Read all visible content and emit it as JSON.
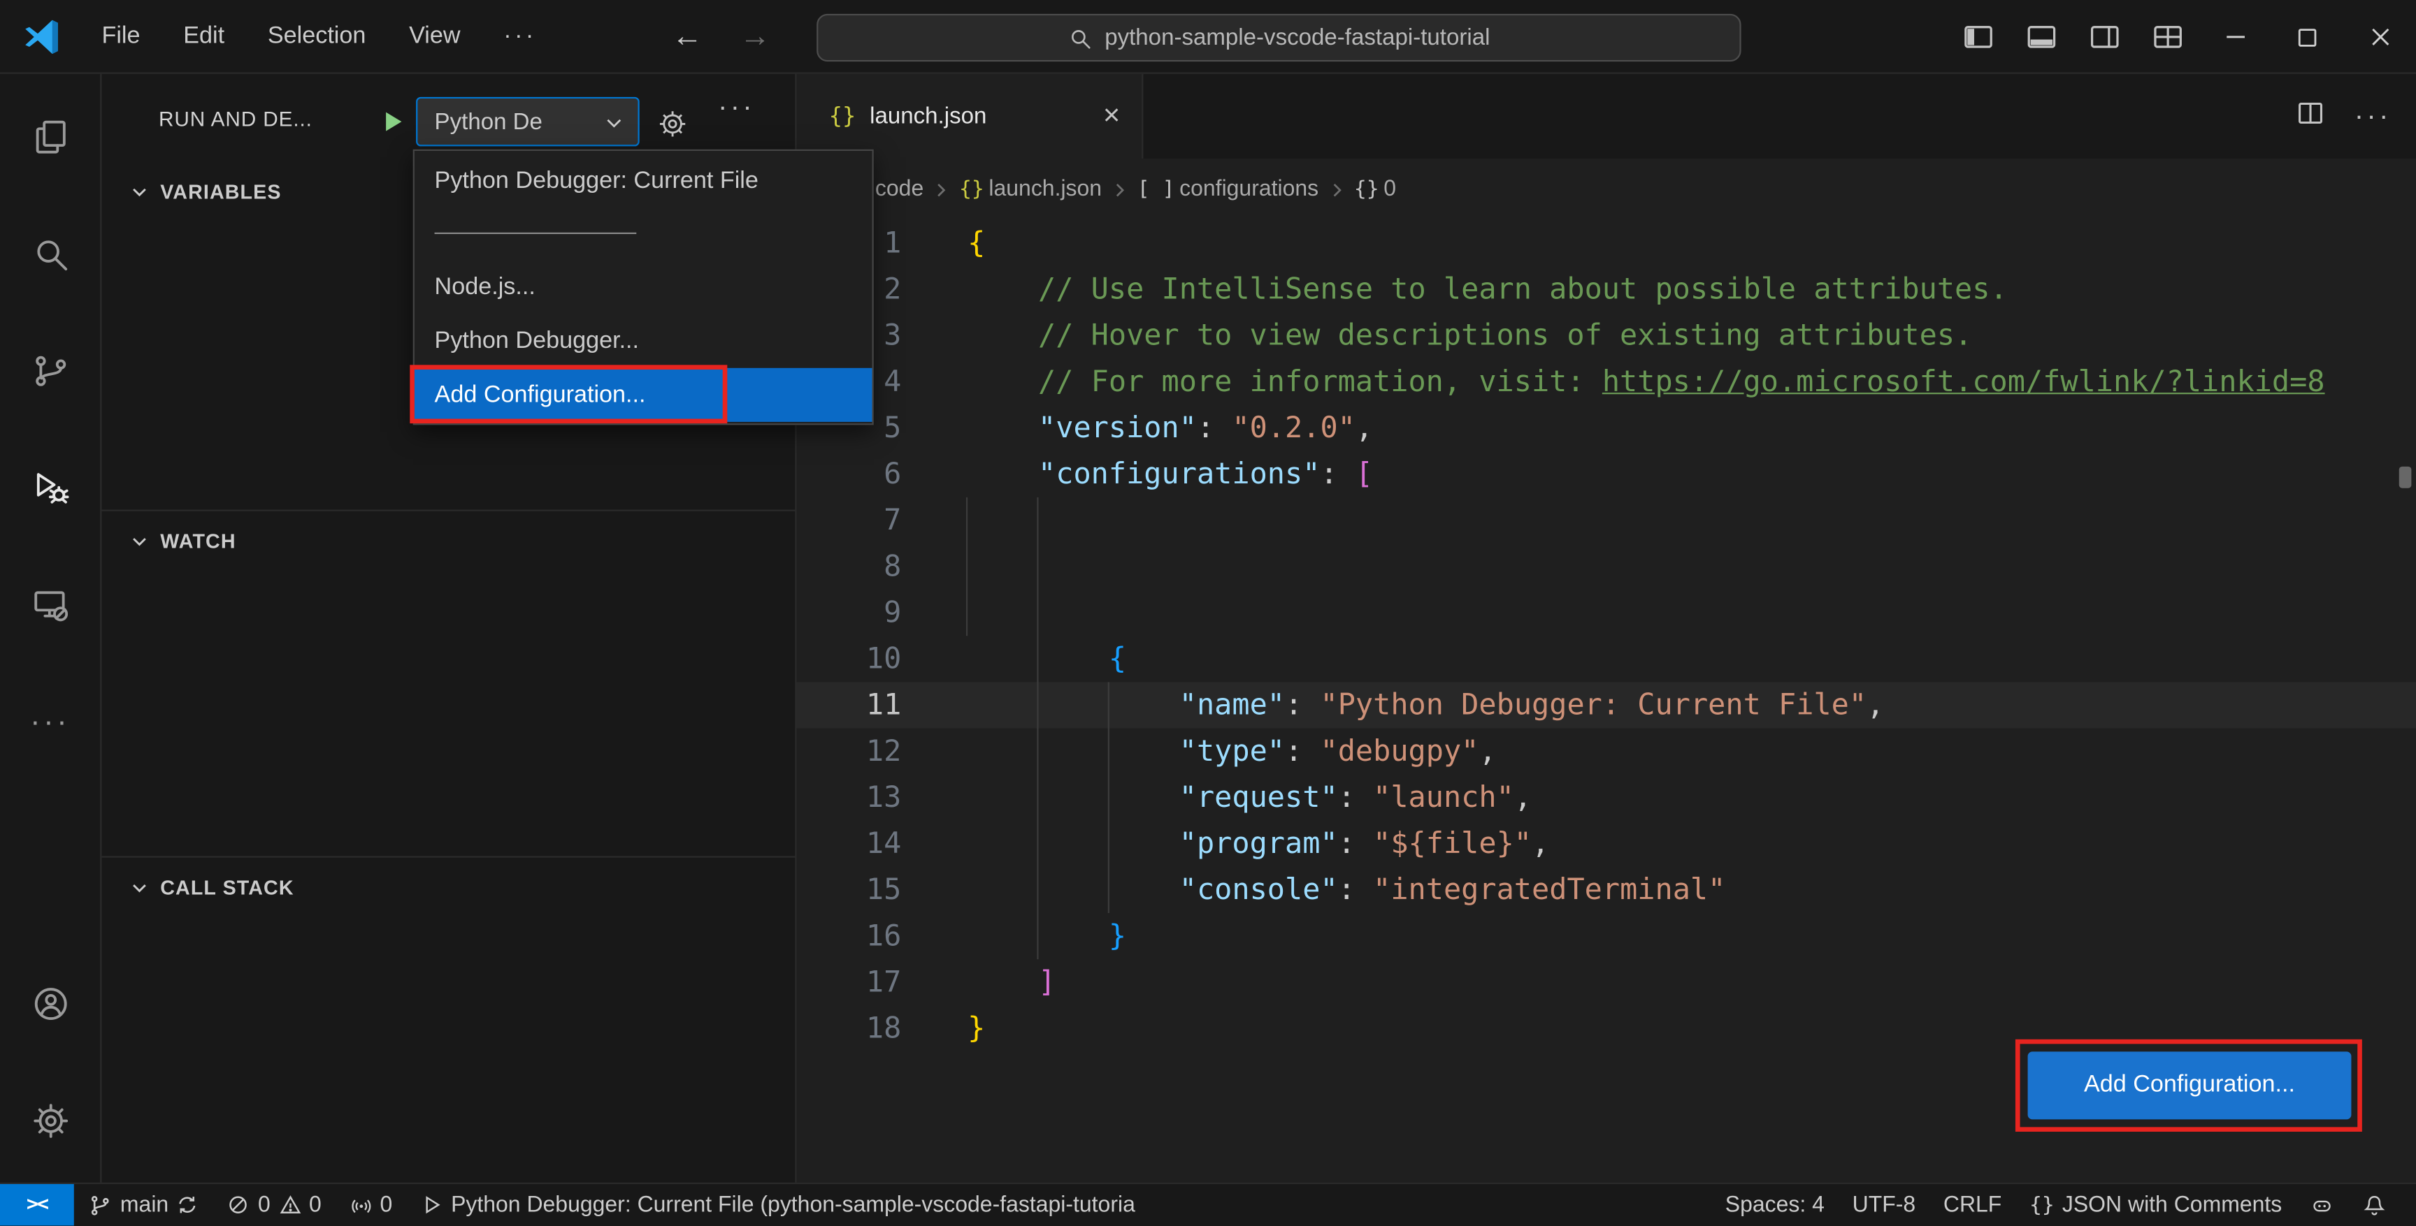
{
  "window": {
    "menus": [
      "File",
      "Edit",
      "Selection",
      "View"
    ],
    "more_menu": "···",
    "back_arrow": "←",
    "forward_arrow": "→",
    "command_center_text": "python-sample-vscode-fastapi-tutorial"
  },
  "activity_bar": {
    "top": [
      {
        "name": "explorer-icon",
        "glyph": "explorer",
        "active": false
      },
      {
        "name": "search-icon",
        "glyph": "search",
        "active": false
      },
      {
        "name": "source-control-icon",
        "glyph": "source-control",
        "active": false
      },
      {
        "name": "run-and-debug-icon",
        "glyph": "run-and-debug",
        "active": true
      },
      {
        "name": "remote-explorer-icon",
        "glyph": "remote-explorer",
        "active": false
      },
      {
        "name": "more-views-icon",
        "glyph": "more-views",
        "active": false
      }
    ],
    "bottom": [
      {
        "name": "accounts-icon",
        "glyph": "accounts",
        "active": false
      },
      {
        "name": "settings-gear-icon",
        "glyph": "settings-gear",
        "active": false
      }
    ]
  },
  "sidebar": {
    "title": "RUN AND DE...",
    "config_select_value": "Python De",
    "sections": [
      "VARIABLES",
      "WATCH",
      "CALL STACK"
    ],
    "config_menu_items": [
      {
        "label": "Python Debugger: Current File"
      },
      {
        "separator": true
      },
      {
        "label": "Node.js..."
      },
      {
        "label": "Python Debugger..."
      },
      {
        "label": "Add Configuration...",
        "selected": true,
        "annotated": true
      }
    ]
  },
  "editor": {
    "tab_label": "launch.json",
    "tab_icon": "{}",
    "breadcrumb": [
      {
        "label": "code"
      },
      {
        "label": "launch.json",
        "icon": "{}",
        "icon_color": "#cbcb41"
      },
      {
        "label": "configurations",
        "icon": "[ ]",
        "icon_color": "#c5c5c5"
      },
      {
        "label": "0",
        "icon": "{}",
        "icon_color": "#c5c5c5"
      }
    ],
    "add_configuration_button": "Add Configuration...",
    "palette": {
      "default": "#cccccc",
      "comment": "#6a9955",
      "key": "#9cdcfe",
      "string": "#ce9178",
      "b1": "#ffd700",
      "b2": "#da70d6",
      "b3": "#179fff"
    },
    "code_lines": [
      {
        "n": 1,
        "s": [
          {
            "t": "{",
            "c": "b1"
          }
        ]
      },
      {
        "n": 2,
        "s": [
          {
            "t": "    // Use IntelliSense to learn about possible attributes.",
            "c": "comment"
          }
        ]
      },
      {
        "n": 3,
        "s": [
          {
            "t": "    // Hover to view descriptions of existing attributes.",
            "c": "comment"
          }
        ]
      },
      {
        "n": 4,
        "s": [
          {
            "t": "    // For more information, visit: ",
            "c": "comment"
          },
          {
            "t": "https://go.microsoft.com/fwlink/?linkid=8",
            "c": "comment",
            "u": true
          }
        ]
      },
      {
        "n": 5,
        "s": [
          {
            "t": "    "
          },
          {
            "t": "\"version\"",
            "c": "key"
          },
          {
            "t": ": "
          },
          {
            "t": "\"0.2.0\"",
            "c": "string"
          },
          {
            "t": ","
          }
        ]
      },
      {
        "n": 6,
        "s": [
          {
            "t": "    "
          },
          {
            "t": "\"configurations\"",
            "c": "key"
          },
          {
            "t": ": "
          },
          {
            "t": "[",
            "c": "b2"
          }
        ]
      },
      {
        "n": 7,
        "s": []
      },
      {
        "n": 8,
        "s": []
      },
      {
        "n": 9,
        "s": []
      },
      {
        "n": 10,
        "s": [
          {
            "t": "        "
          },
          {
            "t": "{",
            "c": "b3"
          }
        ]
      },
      {
        "n": 11,
        "current": true,
        "s": [
          {
            "t": "            "
          },
          {
            "t": "\"name\"",
            "c": "key"
          },
          {
            "t": ": "
          },
          {
            "t": "\"Python Debugger: Current File\"",
            "c": "string"
          },
          {
            "t": ","
          }
        ]
      },
      {
        "n": 12,
        "s": [
          {
            "t": "            "
          },
          {
            "t": "\"type\"",
            "c": "key"
          },
          {
            "t": ": "
          },
          {
            "t": "\"debugpy\"",
            "c": "string"
          },
          {
            "t": ","
          }
        ]
      },
      {
        "n": 13,
        "s": [
          {
            "t": "            "
          },
          {
            "t": "\"request\"",
            "c": "key"
          },
          {
            "t": ": "
          },
          {
            "t": "\"launch\"",
            "c": "string"
          },
          {
            "t": ","
          }
        ]
      },
      {
        "n": 14,
        "s": [
          {
            "t": "            "
          },
          {
            "t": "\"program\"",
            "c": "key"
          },
          {
            "t": ": "
          },
          {
            "t": "\"${file}\"",
            "c": "string"
          },
          {
            "t": ","
          }
        ]
      },
      {
        "n": 15,
        "s": [
          {
            "t": "            "
          },
          {
            "t": "\"console\"",
            "c": "key"
          },
          {
            "t": ": "
          },
          {
            "t": "\"integratedTerminal\"",
            "c": "string"
          }
        ]
      },
      {
        "n": 16,
        "s": [
          {
            "t": "        "
          },
          {
            "t": "}",
            "c": "b3"
          }
        ]
      },
      {
        "n": 17,
        "s": [
          {
            "t": "    "
          },
          {
            "t": "]",
            "c": "b2"
          }
        ]
      },
      {
        "n": 18,
        "s": [
          {
            "t": "}",
            "c": "b1"
          }
        ]
      }
    ]
  },
  "status_bar": {
    "remote": "><",
    "branch": "main",
    "errors": "0",
    "warnings": "0",
    "ports": "0",
    "debug_status": "Python Debugger: Current File (python-sample-vscode-fastapi-tutoria",
    "spaces": "Spaces: 4",
    "encoding": "UTF-8",
    "eol": "CRLF",
    "language": "JSON with Comments",
    "language_icon": "{}"
  },
  "colors": {
    "accent_blue": "#0078d4",
    "selection_blue": "#0a6ac6",
    "button_blue": "#1a73ce",
    "annotation_red": "#e8241f"
  }
}
